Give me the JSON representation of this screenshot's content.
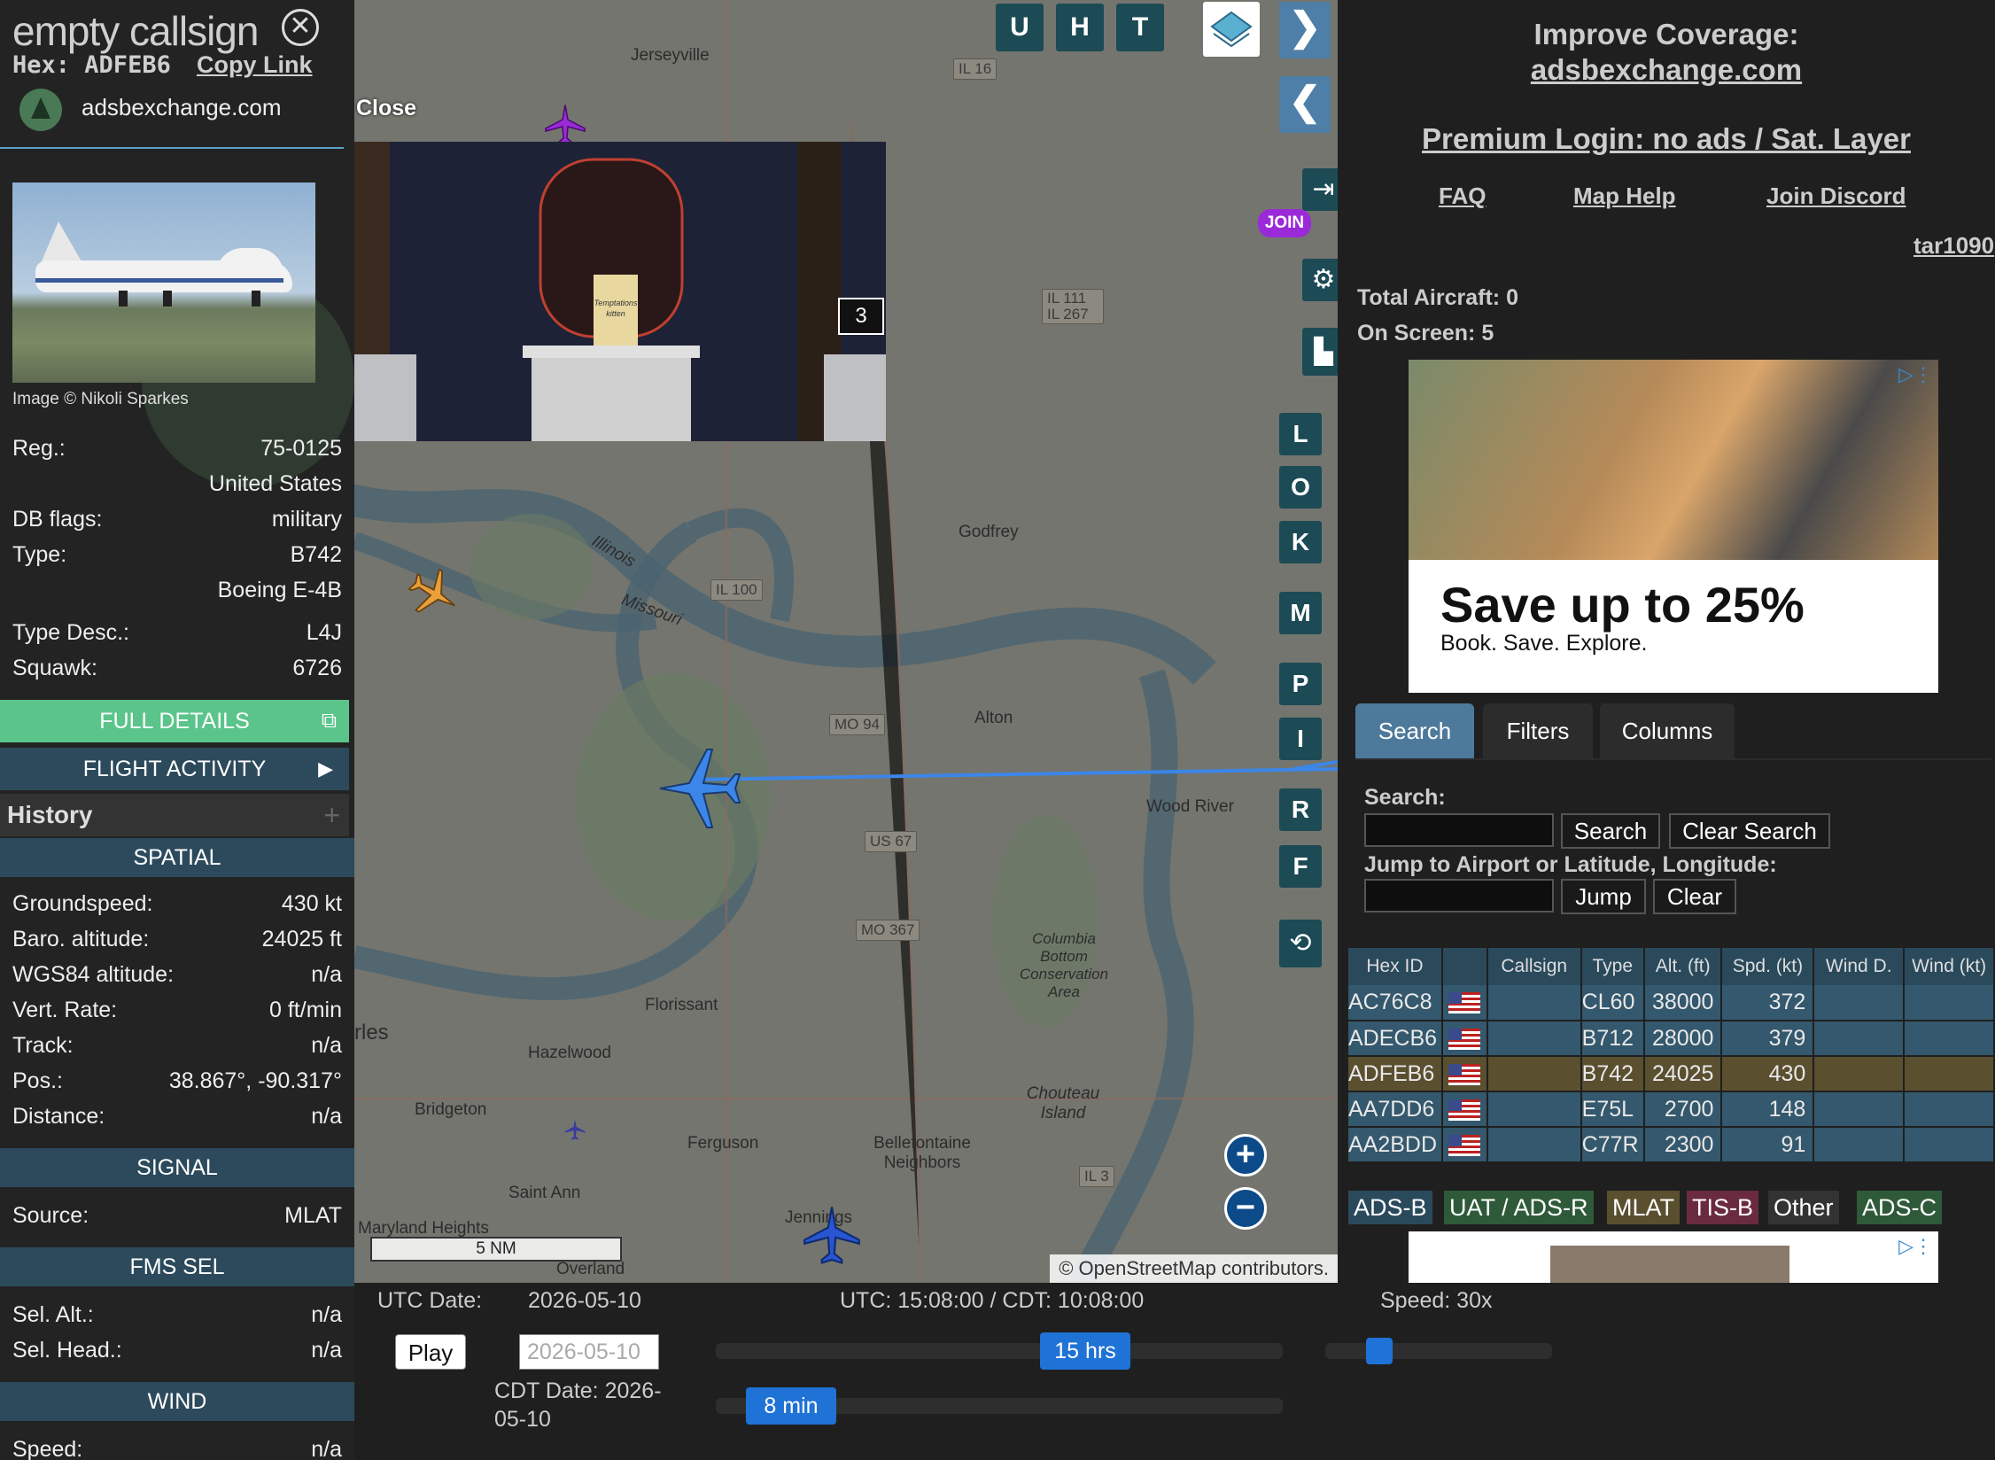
{
  "left": {
    "callsign": "empty callsign",
    "hex_label": "Hex:",
    "hex_value": "ADFEB6",
    "copy_link": "Copy Link",
    "site": "adsbexchange.com",
    "photo_credit": "Image © Nikoli Sparkes",
    "info": [
      {
        "k": "Reg.:",
        "v": "75-0125"
      },
      {
        "k": "",
        "v": "United States"
      },
      {
        "k": "DB flags:",
        "v": "military"
      },
      {
        "k": "Type:",
        "v": "B742"
      },
      {
        "k": "",
        "v": "Boeing E-4B"
      },
      {
        "k": "Type Desc.:",
        "v": "L4J"
      },
      {
        "k": "Squawk:",
        "v": "6726"
      }
    ],
    "full_details": "FULL DETAILS",
    "flight_activity": "FLIGHT ACTIVITY",
    "history": "History",
    "sections": {
      "spatial": "SPATIAL",
      "signal": "SIGNAL",
      "fms": "FMS SEL",
      "wind": "WIND"
    },
    "spatial": [
      {
        "k": "Groundspeed:",
        "v": "430 kt"
      },
      {
        "k": "Baro. altitude:",
        "v": "24025 ft"
      },
      {
        "k": "WGS84 altitude:",
        "v": "n/a"
      },
      {
        "k": "Vert. Rate:",
        "v": "0 ft/min"
      },
      {
        "k": "Track:",
        "v": "n/a"
      },
      {
        "k": "Pos.:",
        "v": "38.867°, -90.317°"
      },
      {
        "k": "Distance:",
        "v": "n/a"
      }
    ],
    "signal": [
      {
        "k": "Source:",
        "v": "MLAT"
      }
    ],
    "fms": [
      {
        "k": "Sel. Alt.:",
        "v": "n/a"
      },
      {
        "k": "Sel. Head.:",
        "v": "n/a"
      }
    ],
    "wind": [
      {
        "k": "Speed:",
        "v": "n/a"
      }
    ]
  },
  "map": {
    "close_label": "Close",
    "video_badge": "3",
    "video_product_label": "Temptations kitten",
    "top_buttons": [
      "U",
      "H",
      "T"
    ],
    "join": "JOIN",
    "side_buttons": [
      "L",
      "O",
      "K",
      "M",
      "P",
      "I",
      "R",
      "F"
    ],
    "scale": "5 NM",
    "attribution": "© OpenStreetMap contributors.",
    "labels": [
      "Jerseyville",
      "Godfrey",
      "Alton",
      "Wood River",
      "Florissant",
      "Hazelwood",
      "Bridgeton",
      "Ferguson",
      "Bellefontaine Neighbors",
      "Saint Ann",
      "Maryland Heights",
      "Overland",
      "Jennings",
      "Chouteau Island",
      "Columbia Bottom Conservation Area",
      "Illinois",
      "Missouri",
      "rles"
    ],
    "shields": [
      "IL 16",
      "IL 111 IL 267",
      "IL 100",
      "MO 94",
      "US 67",
      "MO 367",
      "IL 3"
    ]
  },
  "right": {
    "improve": "Improve Coverage:",
    "improve_link": "adsbexchange.com",
    "premium": "Premium Login: no ads / Sat. Layer",
    "nav": [
      "FAQ",
      "Map Help",
      "Join Discord"
    ],
    "user": "tar1090",
    "total_aircraft": "Total Aircraft: 0",
    "on_screen": "On Screen: 5",
    "ad": {
      "headline": "Save up to 25%",
      "sub": "Book. Save. Explore."
    },
    "tabs": [
      "Search",
      "Filters",
      "Columns"
    ],
    "search_label": "Search:",
    "search_btn": "Search",
    "clear_search_btn": "Clear Search",
    "jump_label": "Jump to Airport or Latitude, Longitude:",
    "jump_btn": "Jump",
    "clear_btn": "Clear",
    "table": {
      "headers": [
        "Hex ID",
        "",
        "Callsign",
        "Type",
        "Alt. (ft)",
        "Spd. (kt)",
        "Wind D.",
        "Wind (kt)"
      ],
      "rows": [
        [
          "AC76C8",
          "",
          "CL60",
          "38000",
          "372"
        ],
        [
          "ADECB6",
          "",
          "B712",
          "28000",
          "379"
        ],
        [
          "ADFEB6",
          "",
          "B742",
          "24025",
          "430"
        ],
        [
          "AA7DD6",
          "",
          "E75L",
          "2700",
          "148"
        ],
        [
          "AA2BDD",
          "",
          "C77R",
          "2300",
          "91"
        ]
      ]
    },
    "legend": [
      {
        "label": "ADS-B",
        "color": "#2a4a5c"
      },
      {
        "label": "UAT / ADS-R",
        "color": "#2f5a3a"
      },
      {
        "label": "MLAT",
        "color": "#5a5030"
      },
      {
        "label": "TIS-B",
        "color": "#6a2a40"
      },
      {
        "label": "Other",
        "color": "#333333"
      },
      {
        "label": "ADS-C",
        "color": "#2f5a3a"
      }
    ]
  },
  "bottom": {
    "utc_date_label": "UTC Date:",
    "utc_date": "2026-05-10",
    "time": "UTC: 15:08:00 / CDT: 10:08:00",
    "speed": "Speed: 30x",
    "play": "Play",
    "date_input": "2026-05-10",
    "cdt_date": "CDT Date: 2026-05-10",
    "hrs_pill": "15 hrs",
    "min_pill": "8 min"
  }
}
